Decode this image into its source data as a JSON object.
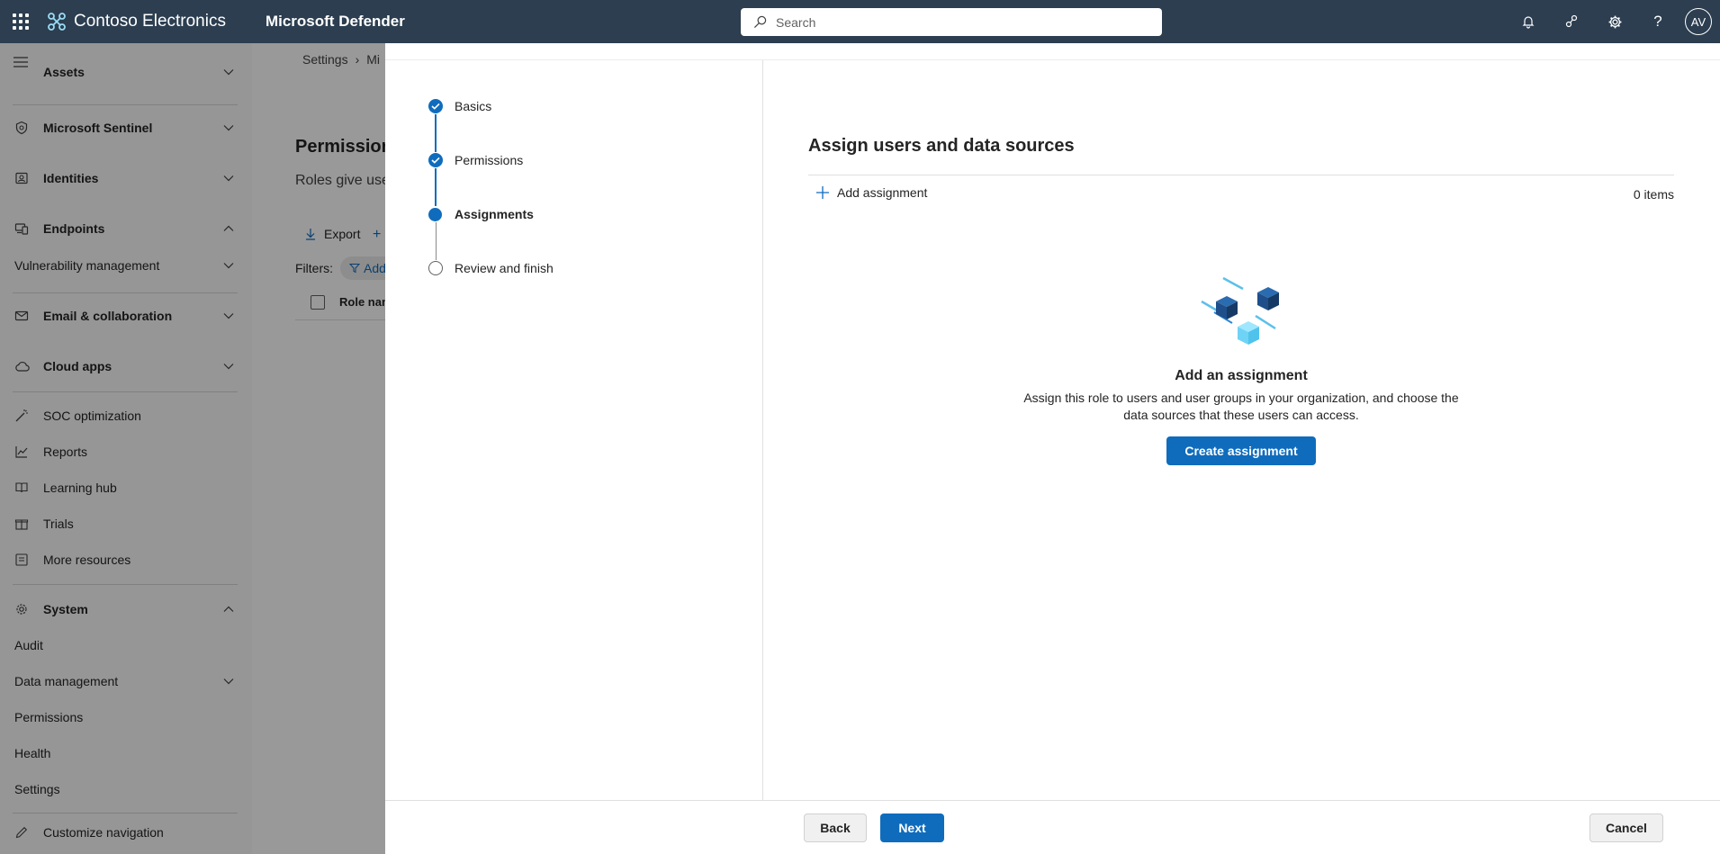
{
  "topbar": {
    "org_name": "Contoso Electronics",
    "product_name": "Microsoft Defender",
    "search_placeholder": "Search",
    "avatar_initials": "AV"
  },
  "nav": {
    "items": [
      {
        "label": "Assets"
      },
      {
        "label": "Microsoft Sentinel"
      },
      {
        "label": "Identities"
      },
      {
        "label": "Endpoints"
      },
      {
        "label": "Vulnerability management"
      },
      {
        "label": "Email & collaboration"
      },
      {
        "label": "Cloud apps"
      },
      {
        "label": "SOC optimization"
      },
      {
        "label": "Reports"
      },
      {
        "label": "Learning hub"
      },
      {
        "label": "Trials"
      },
      {
        "label": "More resources"
      },
      {
        "label": "System"
      },
      {
        "label": "Audit"
      },
      {
        "label": "Data management"
      },
      {
        "label": "Permissions"
      },
      {
        "label": "Health"
      },
      {
        "label": "Settings"
      },
      {
        "label": "Customize navigation"
      }
    ]
  },
  "background_page": {
    "breadcrumb": [
      "Settings",
      "Mi"
    ],
    "title": "Permission",
    "description": "Roles give use",
    "export_label": "Export",
    "filters_label": "Filters:",
    "filter_chip": "Add",
    "column_role_name": "Role nam"
  },
  "wizard": {
    "steps": [
      {
        "label": "Basics",
        "state": "done"
      },
      {
        "label": "Permissions",
        "state": "done"
      },
      {
        "label": "Assignments",
        "state": "current"
      },
      {
        "label": "Review and finish",
        "state": "todo"
      }
    ],
    "title": "Assign users and data sources",
    "add_assignment_label": "Add assignment",
    "items_count": "0 items",
    "empty_title": "Add an assignment",
    "empty_description": "Assign this role to users and user groups in your organization, and choose the data sources that these users can access.",
    "create_button": "Create assignment",
    "back_button": "Back",
    "next_button": "Next",
    "cancel_button": "Cancel"
  },
  "colors": {
    "topbar": "#2c3e50",
    "accent": "#0f6cbd"
  }
}
